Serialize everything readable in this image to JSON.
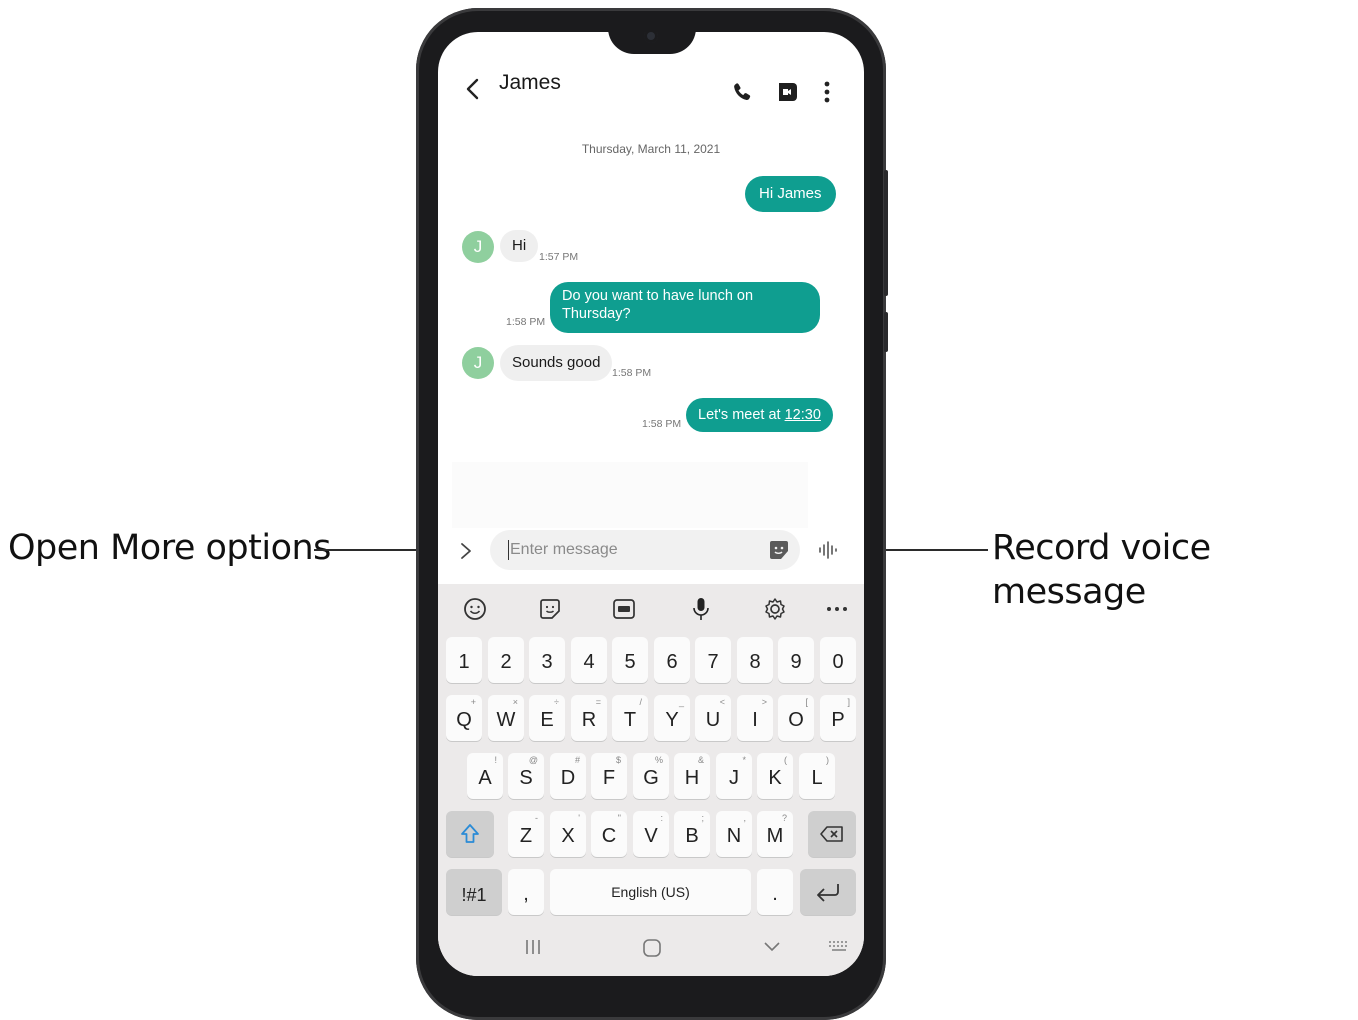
{
  "callouts": {
    "left": "Open More options",
    "right": "Record voice message"
  },
  "header": {
    "contact_name": "James",
    "icons": [
      "back-icon",
      "call-icon",
      "video-call-icon",
      "more-vert-icon"
    ]
  },
  "conversation": {
    "date": "Thursday, March 11, 2021",
    "messages": [
      {
        "direction": "out",
        "text": "Hi James",
        "time": ""
      },
      {
        "direction": "in",
        "avatar": "J",
        "text": "Hi",
        "time": "1:57 PM"
      },
      {
        "direction": "out",
        "text_line1": "Do you want to have lunch on",
        "text_line2": "Thursday?",
        "time": "1:58 PM"
      },
      {
        "direction": "in",
        "avatar": "J",
        "text": "Sounds good",
        "time": "1:58 PM"
      },
      {
        "direction": "out",
        "text_prefix": "Let's meet at ",
        "text_link": "12:30",
        "time": "1:58 PM"
      }
    ]
  },
  "compose": {
    "placeholder": "Enter message",
    "icons": [
      "chevron-right-icon",
      "sticker-icon",
      "voice-waveform-icon"
    ]
  },
  "keyboard": {
    "toolbar": [
      "emoji-icon",
      "sticker-icon",
      "gif-icon",
      "microphone-icon",
      "settings-icon",
      "more-horiz-icon"
    ],
    "row_numbers": [
      "1",
      "2",
      "3",
      "4",
      "5",
      "6",
      "7",
      "8",
      "9",
      "0"
    ],
    "row_q": [
      {
        "k": "Q",
        "h": "+"
      },
      {
        "k": "W",
        "h": "×"
      },
      {
        "k": "E",
        "h": "÷"
      },
      {
        "k": "R",
        "h": "="
      },
      {
        "k": "T",
        "h": "/"
      },
      {
        "k": "Y",
        "h": "_"
      },
      {
        "k": "U",
        "h": "<"
      },
      {
        "k": "I",
        "h": ">"
      },
      {
        "k": "O",
        "h": "["
      },
      {
        "k": "P",
        "h": "]"
      }
    ],
    "row_a": [
      {
        "k": "A",
        "h": "!"
      },
      {
        "k": "S",
        "h": "@"
      },
      {
        "k": "D",
        "h": "#"
      },
      {
        "k": "F",
        "h": "$"
      },
      {
        "k": "G",
        "h": "%"
      },
      {
        "k": "H",
        "h": "&"
      },
      {
        "k": "J",
        "h": "*"
      },
      {
        "k": "K",
        "h": "("
      },
      {
        "k": "L",
        "h": ")"
      }
    ],
    "row_z": [
      {
        "k": "Z",
        "h": "-"
      },
      {
        "k": "X",
        "h": "'"
      },
      {
        "k": "C",
        "h": "\""
      },
      {
        "k": "V",
        "h": ":"
      },
      {
        "k": "B",
        "h": ";"
      },
      {
        "k": "N",
        "h": ","
      },
      {
        "k": "M",
        "h": "?"
      }
    ],
    "symbols_key": "!#1",
    "comma_key": ",",
    "space_key": "English (US)",
    "period_key": ".",
    "shift_icon": "shift-icon",
    "backspace_icon": "backspace-icon",
    "enter_icon": "enter-icon"
  },
  "navbar": {
    "icons": [
      "recents-icon",
      "home-icon",
      "back-chevron-icon",
      "keyboard-icon"
    ]
  },
  "colors": {
    "accent": "#0f9e90",
    "avatar": "#8fcf9e",
    "keyboard_bg": "#eceaea"
  }
}
